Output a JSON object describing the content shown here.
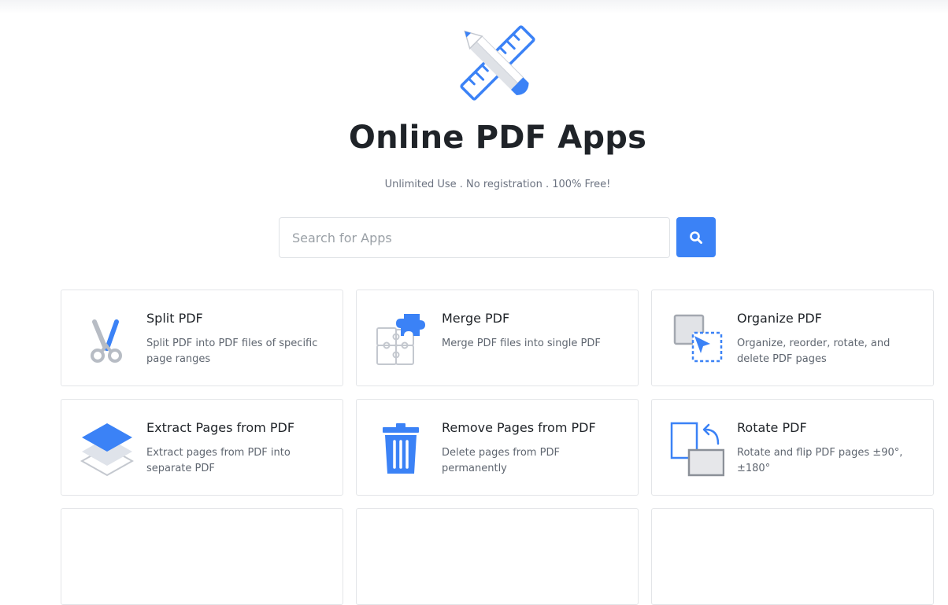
{
  "header": {
    "title": "Online PDF Apps",
    "subtitle": "Unlimited Use . No registration . 100% Free!",
    "logo_icon": "pencil-ruler-icon"
  },
  "search": {
    "placeholder": "Search for Apps",
    "value": "",
    "button_icon": "search-icon"
  },
  "colors": {
    "accent": "#3b82f6",
    "icon_gray": "#b7bcc4",
    "border": "#e3e5e8"
  },
  "apps": [
    {
      "name": "Split PDF",
      "description": "Split PDF into PDF files of specific page ranges",
      "icon": "scissors-icon"
    },
    {
      "name": "Merge PDF",
      "description": "Merge PDF files into single PDF",
      "icon": "puzzle-icon"
    },
    {
      "name": "Organize PDF",
      "description": "Organize, reorder, rotate, and delete PDF pages",
      "icon": "organize-pages-icon"
    },
    {
      "name": "Extract Pages from PDF",
      "description": "Extract pages from PDF into separate PDF",
      "icon": "layers-icon"
    },
    {
      "name": "Remove Pages from PDF",
      "description": "Delete pages from PDF permanently",
      "icon": "trash-icon"
    },
    {
      "name": "Rotate PDF",
      "description": "Rotate and flip PDF pages ±90°, ±180°",
      "icon": "rotate-page-icon"
    }
  ]
}
